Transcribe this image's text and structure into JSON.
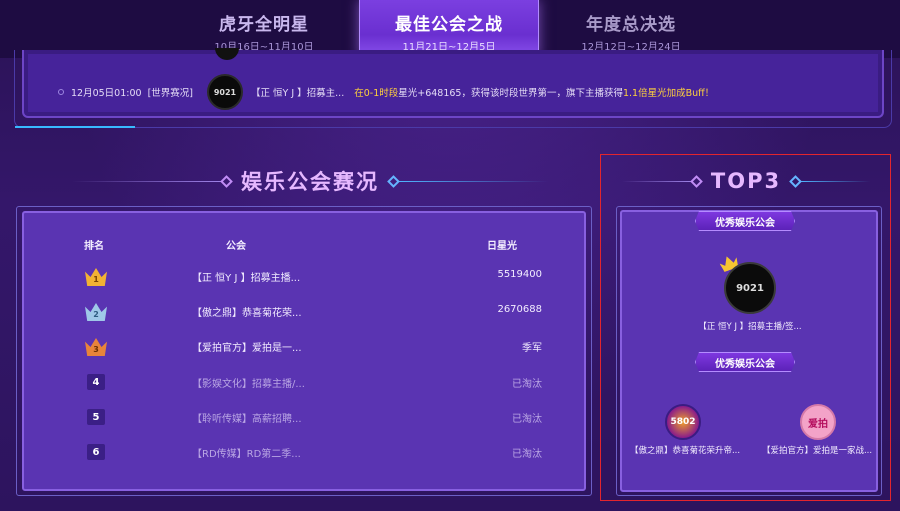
{
  "tabs": [
    {
      "title": "虎牙全明星",
      "date": "10月16日~11月10日"
    },
    {
      "title": "最佳公会之战",
      "date": "11月21日~12月5日"
    },
    {
      "title": "年度总决选",
      "date": "12月12日~12月24日"
    }
  ],
  "feed": {
    "time": "12月05日01:00",
    "tag": "[世界赛况]",
    "avatar_text": "9021",
    "name": "【正 恒Y J 】招募主...",
    "highlight1": "在0-1时段",
    "text1": "星光+648165，获得该时段世界第一，旗下主播获得",
    "highlight2": "1.1倍星光加成Buff！"
  },
  "entertainment": {
    "title": "娱乐公会赛况",
    "headers": {
      "rank": "排名",
      "guild": "公会",
      "star": "日星光"
    },
    "rows": [
      {
        "rank": "1",
        "guild": "【正 恒Y J 】招募主播...",
        "star": "5519400",
        "badge_color": "#f2b233"
      },
      {
        "rank": "2",
        "guild": "【傲之鼎】恭喜菊花荣...",
        "star": "2670688",
        "badge_color": "#9fc8e8"
      },
      {
        "rank": "3",
        "guild": "【爱拍官方】爱拍是一...",
        "star": "季军",
        "badge_color": "#e8843a"
      },
      {
        "rank": "4",
        "guild": "【影娱文化】招募主播/...",
        "star": "已淘汰"
      },
      {
        "rank": "5",
        "guild": "【聆听传媒】高薪招聘...",
        "star": "已淘汰"
      },
      {
        "rank": "6",
        "guild": "【RD传媒】RD第二季...",
        "star": "已淘汰"
      }
    ]
  },
  "top3": {
    "title": "TOP3",
    "ribbon1": "优秀娱乐公会",
    "ribbon2": "优秀娱乐公会",
    "first": {
      "avatar_text": "9021",
      "name": "【正 恒Y J 】招募主播/签..."
    },
    "second": {
      "avatar_text": "5802",
      "name": "【傲之鼎】恭喜菊花荣升帝..."
    },
    "third": {
      "avatar_text": "爱拍",
      "name": "【爱拍官方】爱拍是一家战..."
    }
  },
  "colors": {
    "highlight": "#ffd23c",
    "frame_red": "#e3252d",
    "accent_blue": "#38b9ff"
  }
}
